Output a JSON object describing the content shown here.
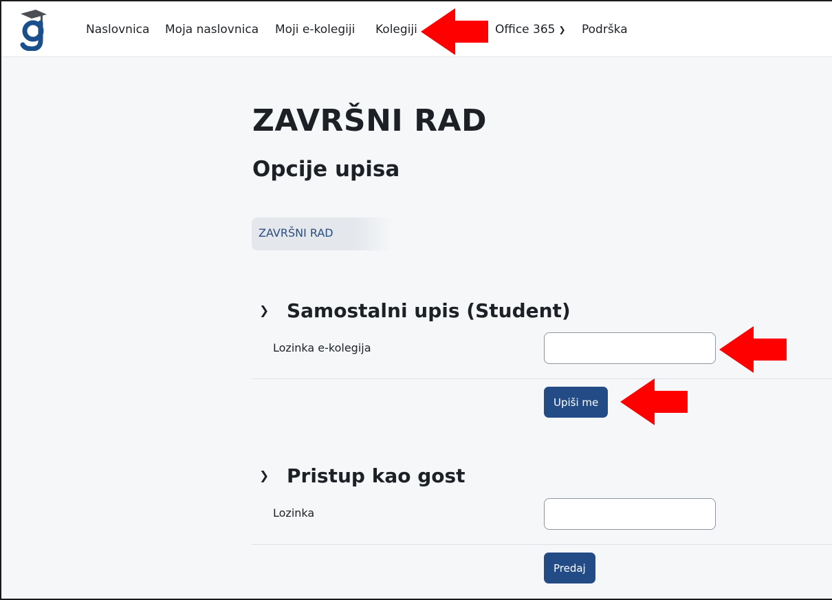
{
  "nav": {
    "items": [
      "Naslovnica",
      "Moja naslovnica",
      "Moji e-kolegiji",
      "Kolegiji"
    ],
    "office_label": "Office 365",
    "support_label": "Podrška"
  },
  "page": {
    "title": "ZAVRŠNI RAD",
    "subtitle": "Opcije upisa",
    "breadcrumb": "ZAVRŠNI RAD"
  },
  "self_enrol": {
    "heading": "Samostalni upis (Student)",
    "field_label": "Lozinka e-kolegija",
    "field_value": "",
    "button_label": "Upiši me"
  },
  "guest": {
    "heading": "Pristup kao gost",
    "field_label": "Lozinka",
    "field_value": "",
    "button_label": "Predaj"
  },
  "colors": {
    "primary_button": "#234c86",
    "annotation_arrow": "#ff0000",
    "logo_blue": "#1b4f8c"
  },
  "icons": {
    "logo": "graduation-cap-g-logo",
    "dropdown": "chevron-down-icon",
    "section_toggle": "chevron-down-icon",
    "annotation": "red-arrow-icon"
  }
}
